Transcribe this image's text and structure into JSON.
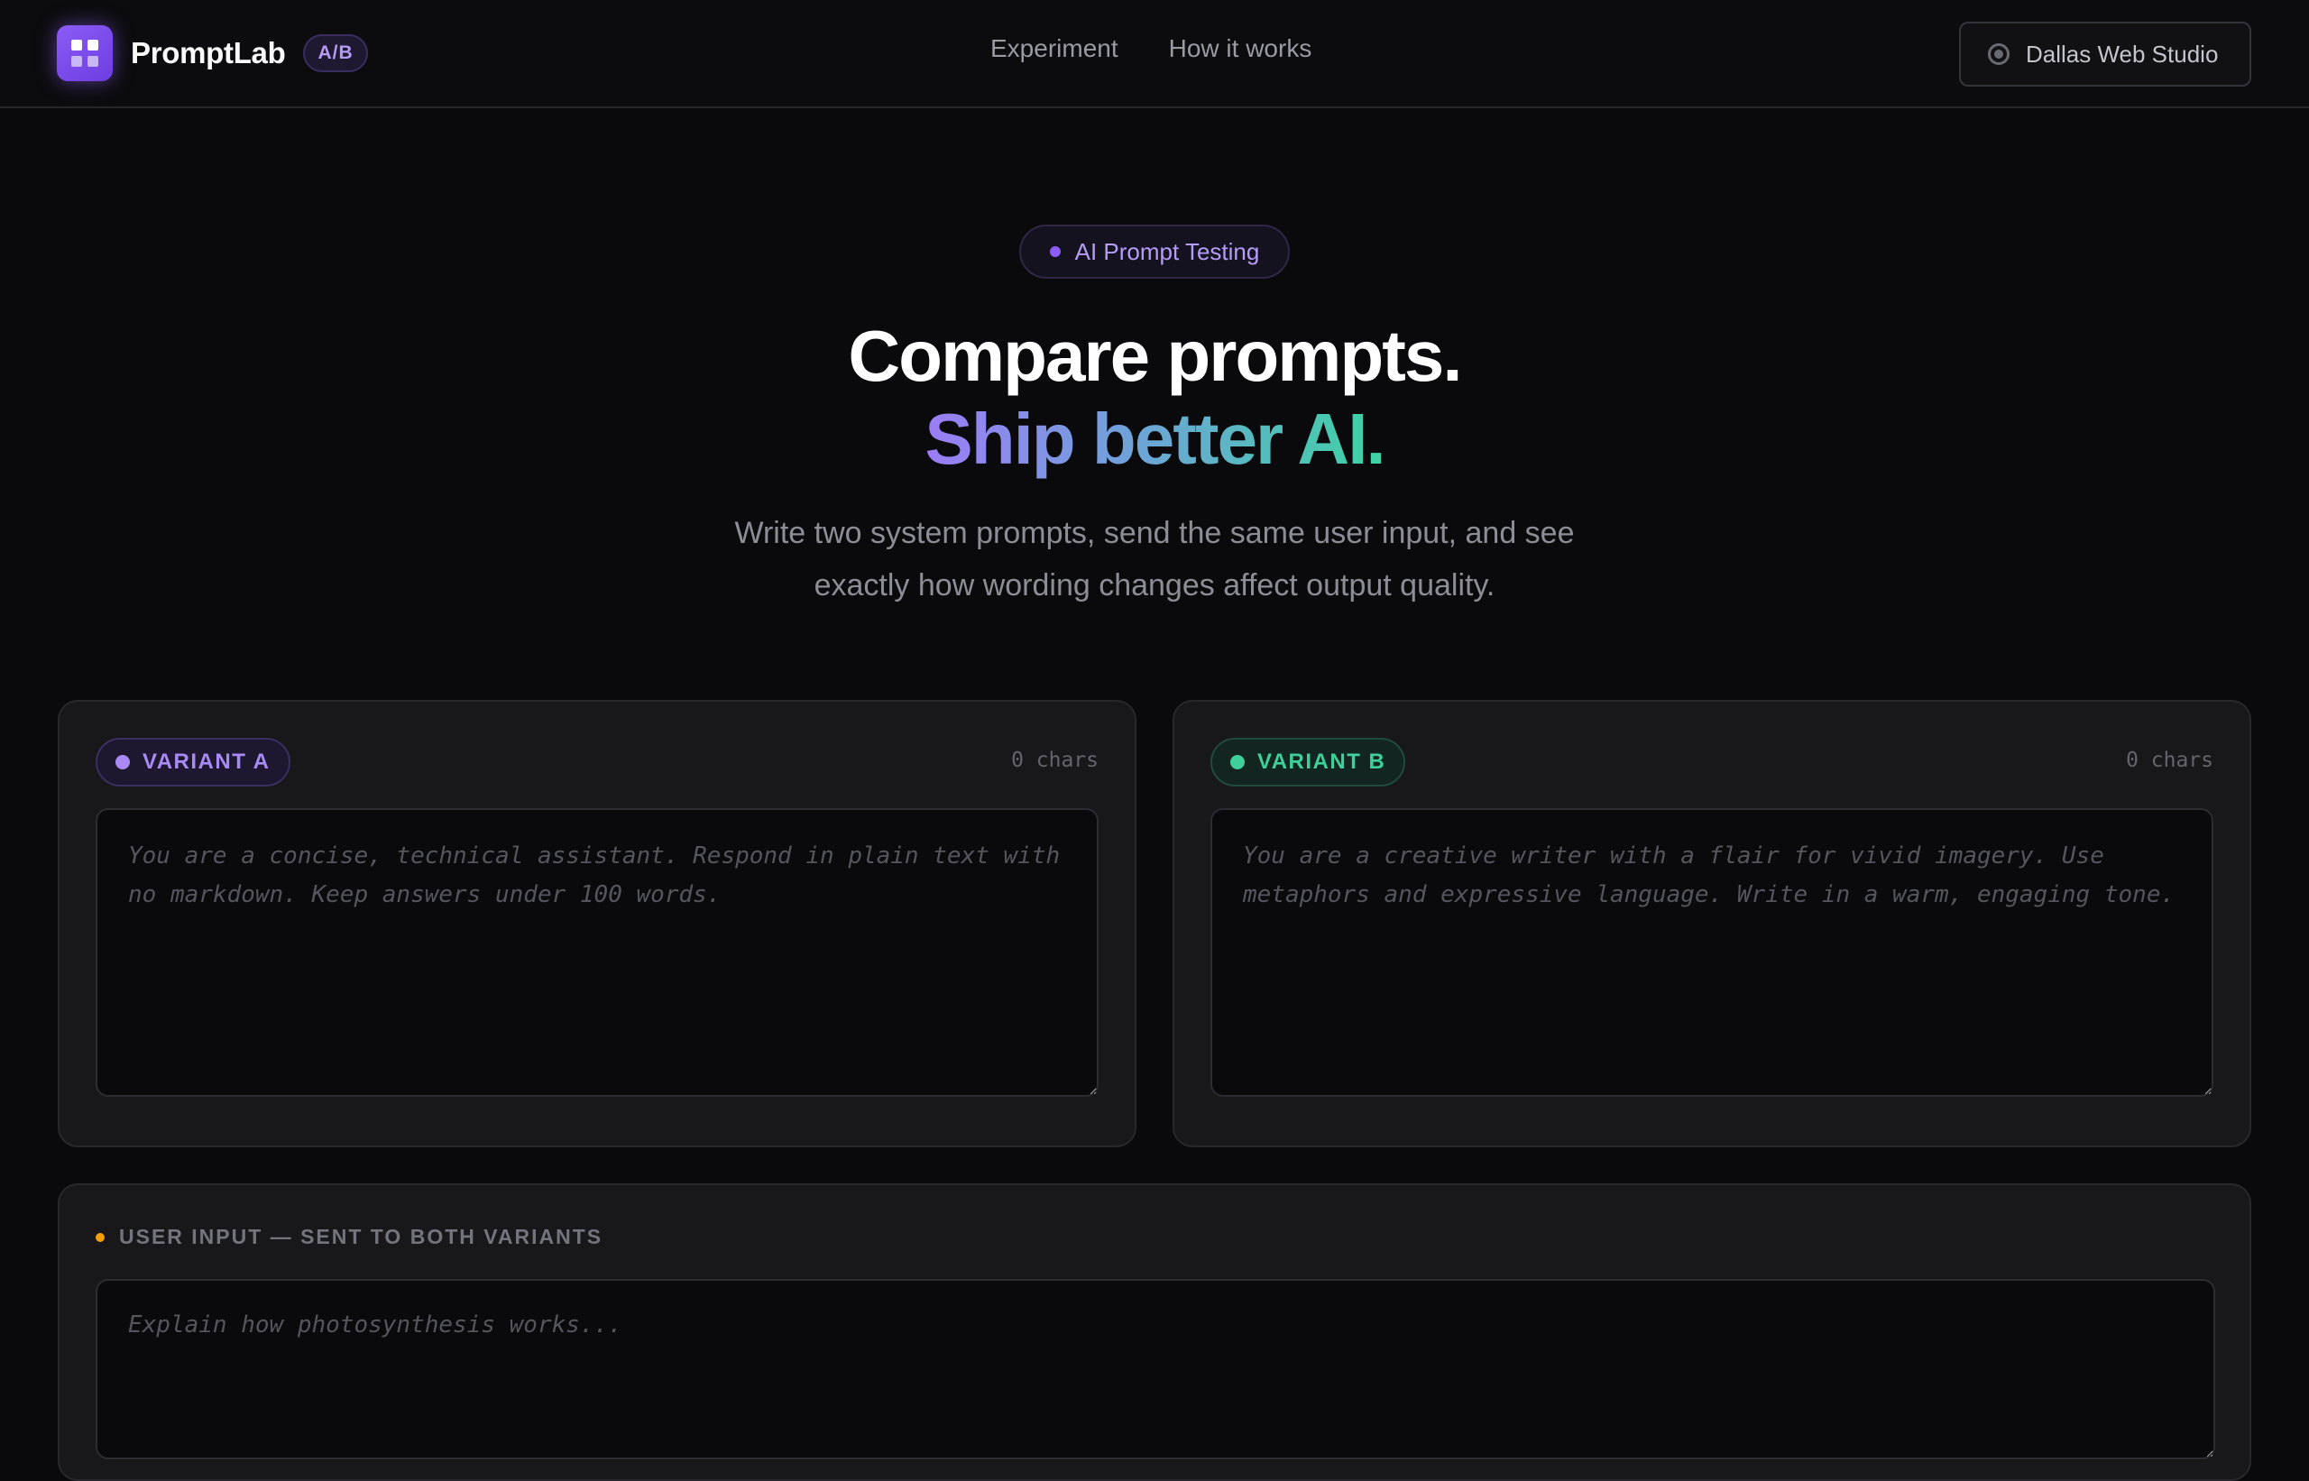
{
  "header": {
    "brand_name": "PromptLab",
    "brand_badge": "A/B",
    "nav": [
      {
        "label": "Experiment"
      },
      {
        "label": "How it works"
      }
    ],
    "studio_label": "Dallas Web Studio",
    "icons": {
      "logo": "grid-logo-icon",
      "studio": "radio-icon"
    }
  },
  "hero": {
    "pill_label": "AI Prompt Testing",
    "title_line1": "Compare prompts.",
    "title_line2": "Ship better AI.",
    "subtitle": "Write two system prompts, send the same user input, and see exactly how wording changes affect output quality."
  },
  "variants": [
    {
      "label": "VARIANT A",
      "chars": "0 chars",
      "value": "",
      "placeholder": "You are a concise, technical assistant. Respond in plain text with no markdown. Keep answers under 100 words.",
      "color": "#a98af5"
    },
    {
      "label": "VARIANT B",
      "chars": "0 chars",
      "value": "",
      "placeholder": "You are a creative writer with a flair for vivid imagery. Use metaphors and expressive language. Write in a warm, engaging tone.",
      "color": "#3ecf9b"
    }
  ],
  "user_input": {
    "label": "USER INPUT — SENT TO BOTH VARIANTS",
    "value": "",
    "placeholder": "Explain how photosynthesis works...",
    "color": "#f59e0b"
  },
  "colors": {
    "background": "#0a0a0c",
    "accent": "#8b5cf6",
    "variant_a": "#a98af5",
    "variant_b": "#3ecf9b",
    "user_input": "#f59e0b"
  }
}
